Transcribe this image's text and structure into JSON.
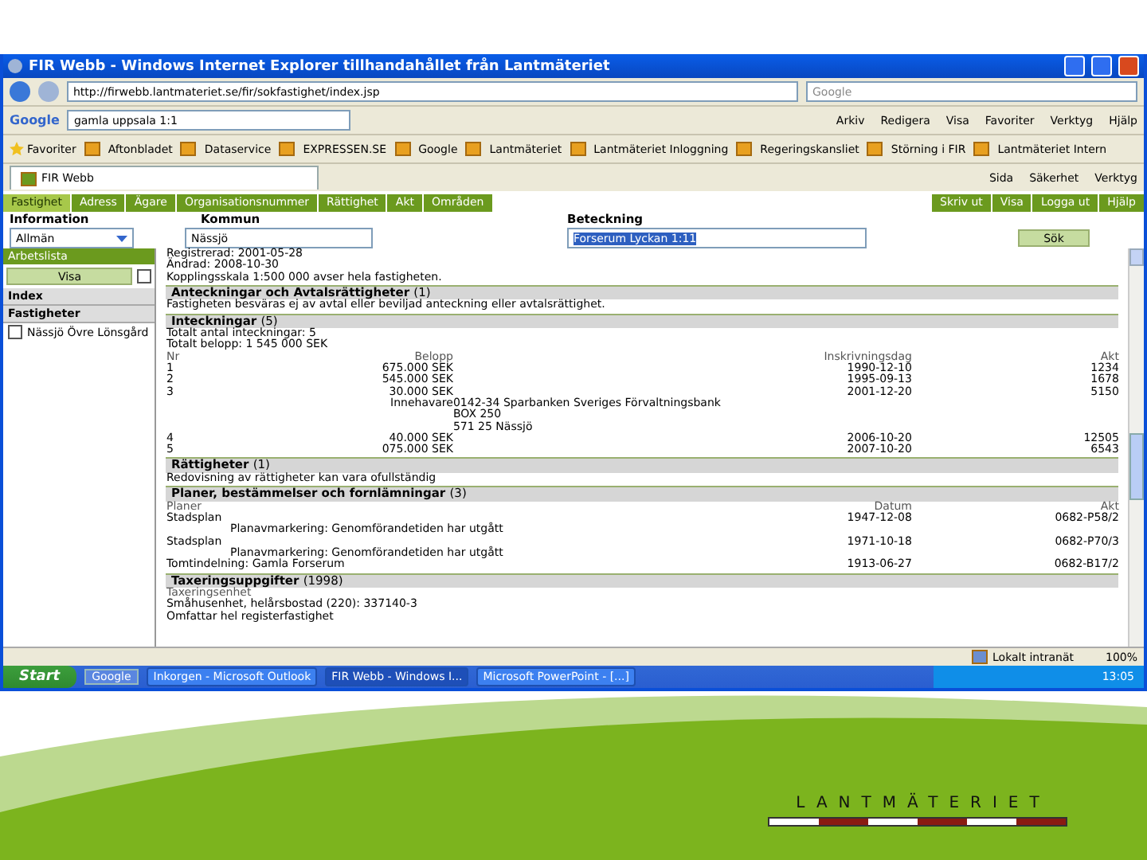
{
  "window": {
    "title": "FIR Webb - Windows Internet Explorer tillhandahållet från Lantmäteriet"
  },
  "address_bar": {
    "url": "http://firwebb.lantmateriet.se/fir/sokfastighet/index.jsp",
    "search_placeholder": "Google"
  },
  "google_toolbar": {
    "logo": "Google",
    "query": "gamla uppsala 1:1",
    "menu": [
      "Arkiv",
      "Redigera",
      "Visa",
      "Favoriter",
      "Verktyg",
      "Hjälp"
    ]
  },
  "favorites": {
    "label": "Favoriter",
    "items": [
      "Aftonbladet",
      "Dataservice",
      "EXPRESSEN.SE",
      "Google",
      "Lantmäteriet",
      "Lantmäteriet Inloggning",
      "Regeringskansliet",
      "Störning i FIR",
      "Lantmäteriet Intern"
    ]
  },
  "browser_tabs": {
    "tab": "FIR Webb",
    "commands": [
      "Sida",
      "Säkerhet",
      "Verktyg"
    ]
  },
  "app_tabs": [
    {
      "label": "Fastighet",
      "selected": true
    },
    {
      "label": "Adress",
      "selected": false
    },
    {
      "label": "Ägare",
      "selected": false
    },
    {
      "label": "Organisationsnummer",
      "selected": false
    },
    {
      "label": "Rättighet",
      "selected": false
    },
    {
      "label": "Akt",
      "selected": false
    },
    {
      "label": "Områden",
      "selected": false
    }
  ],
  "app_links": [
    "Skriv ut",
    "Visa",
    "Logga ut",
    "Hjälp"
  ],
  "search_form": {
    "info_label": "Information",
    "info_value": "Allmän",
    "kommun_label": "Kommun",
    "kommun_value": "Nässjö",
    "beteckning_label": "Beteckning",
    "beteckning_value": "Forserum Lyckan 1:11",
    "button": "Sök"
  },
  "sidebar": {
    "worklist_title": "Arbetslista",
    "view_button": "Visa",
    "view_checked": false,
    "index_title": "Index",
    "properties_title": "Fastigheter",
    "items": [
      {
        "label": "Nässjö Övre Lönsgård",
        "checked": false
      }
    ]
  },
  "content": [
    {
      "kind": "text",
      "text": "Registrerad: 2001-05-28"
    },
    {
      "kind": "text",
      "text": "Ändrad: 2008-10-30"
    },
    {
      "kind": "text",
      "text": "Kopplingsskala 1:500 000 avser hela fastigheten."
    },
    {
      "kind": "header",
      "title": "Anteckningar och Avtalsrättigheter",
      "count": "(1)"
    },
    {
      "kind": "text",
      "text": "Fastigheten besväras ej av avtal eller beviljad anteckning eller avtalsrättighet."
    },
    {
      "kind": "header",
      "title": "Inteckningar",
      "count": "(5)"
    },
    {
      "kind": "text",
      "text": "Totalt antal inteckningar: 5"
    },
    {
      "kind": "text",
      "text": "Totalt belopp: 1 545 000 SEK"
    },
    {
      "kind": "columns",
      "cells": [
        "Nr",
        "Belopp",
        "",
        "Inskrivningsdag",
        "Akt"
      ]
    },
    {
      "kind": "row",
      "cells": [
        "1",
        "675.000 SEK",
        "",
        "1990-12-10",
        "1234"
      ]
    },
    {
      "kind": "row",
      "cells": [
        "2",
        "545.000 SEK",
        "",
        "1995-09-13",
        "1678"
      ]
    },
    {
      "kind": "row",
      "cells": [
        "3",
        "30.000 SEK",
        "",
        "2001-12-20",
        "5150"
      ]
    },
    {
      "kind": "row",
      "cells": [
        "",
        "Innehavare",
        "0142-34 Sparbanken Sveriges Förvaltningsbank",
        "",
        ""
      ]
    },
    {
      "kind": "row",
      "cells": [
        "",
        "",
        "BOX 250",
        "",
        ""
      ]
    },
    {
      "kind": "row",
      "cells": [
        "",
        "",
        "571 25 Nässjö",
        "",
        ""
      ]
    },
    {
      "kind": "row",
      "cells": [
        "4",
        "40.000 SEK",
        "",
        "2006-10-20",
        "12505"
      ]
    },
    {
      "kind": "row",
      "cells": [
        "5",
        "075.000 SEK",
        "",
        "2007-10-20",
        "6543"
      ]
    },
    {
      "kind": "header",
      "title": "Rättigheter",
      "count": "(1)"
    },
    {
      "kind": "text",
      "text": "Redovisning av rättigheter kan vara ofullständig"
    },
    {
      "kind": "header",
      "title": "Planer, bestämmelser och fornlämningar",
      "count": "(3)"
    },
    {
      "kind": "columns",
      "cells": [
        "Planer",
        "",
        "",
        "Datum",
        "Akt"
      ]
    },
    {
      "kind": "row",
      "cells": [
        "Stadsplan",
        "",
        "",
        "1947-12-08",
        "0682-P58/2"
      ]
    },
    {
      "kind": "note",
      "text": "Planavmarkering: Genomförandetiden har utgått"
    },
    {
      "kind": "row",
      "cells": [
        "Stadsplan",
        "",
        "",
        "1971-10-18",
        "0682-P70/3"
      ]
    },
    {
      "kind": "note",
      "text": "Planavmarkering: Genomförandetiden har utgått"
    },
    {
      "kind": "row",
      "cells": [
        "Tomtindelning: Gamla Forserum",
        "",
        "",
        "1913-06-27",
        "0682-B17/2"
      ]
    },
    {
      "kind": "header",
      "title": "Taxeringsuppgifter",
      "count": "(1998)"
    },
    {
      "kind": "caption",
      "text": "Taxeringsenhet"
    },
    {
      "kind": "text",
      "text": "Småhusenhet, helårsbostad (220): 337140-3"
    },
    {
      "kind": "text",
      "text": "Omfattar hel registerfastighet"
    }
  ],
  "status_bar": {
    "zone": "Lokalt intranät",
    "zoom": "100%"
  },
  "taskbar": {
    "start": "Start",
    "quick": "Google",
    "windows": [
      {
        "label": "Inkorgen - Microsoft Outlook",
        "selected": false
      },
      {
        "label": "FIR Webb - Windows I...",
        "selected": true
      },
      {
        "label": "Microsoft PowerPoint - [...]",
        "selected": false
      }
    ],
    "clock": "13:05"
  },
  "logo": {
    "text": "LANTMÄTERIET"
  }
}
